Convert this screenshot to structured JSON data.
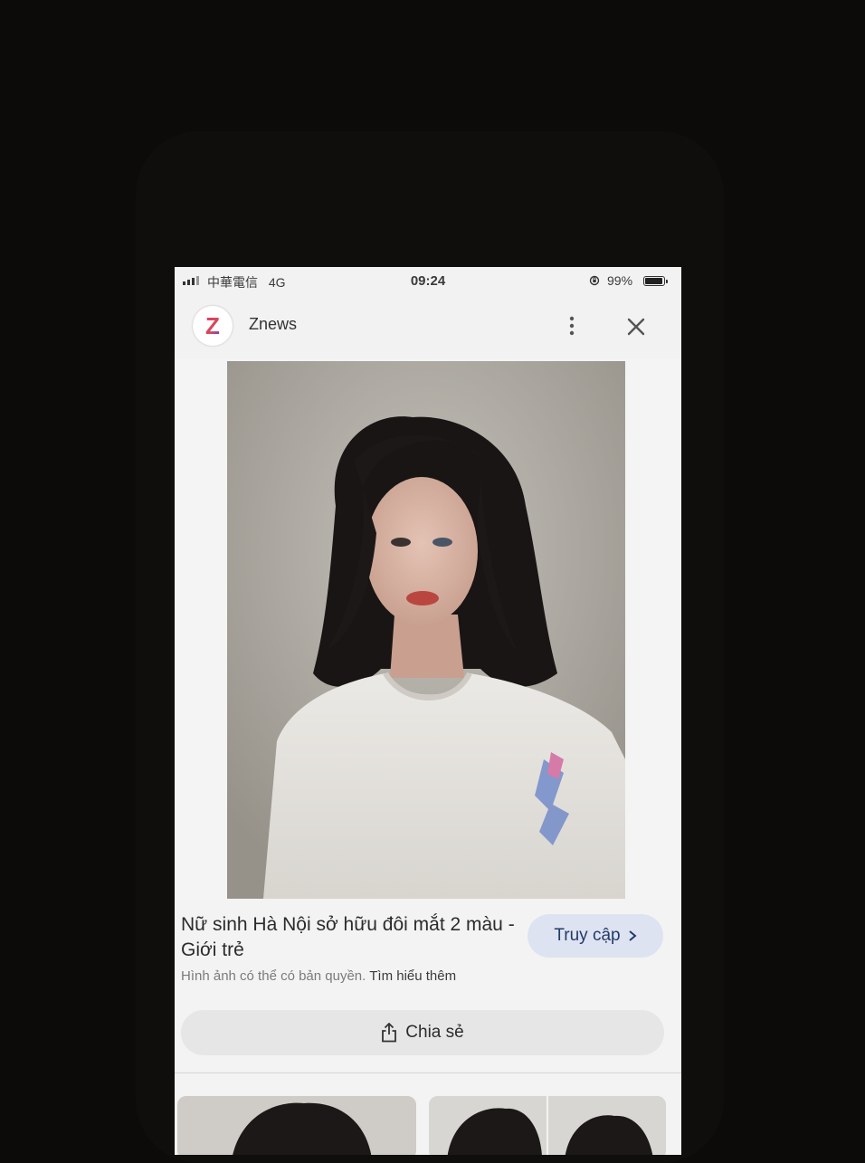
{
  "status_bar": {
    "carrier": "中華電信",
    "network": "4G",
    "time": "09:24",
    "battery": "99%"
  },
  "header": {
    "logo_letter": "Z",
    "site_name": "Znews"
  },
  "result": {
    "title": "Nữ sinh Hà Nội sở hữu đôi mắt 2 màu - Giới trẻ",
    "visit_label": "Truy cập",
    "copyright_text": "Hình ảnh có thể có bản quyền.",
    "learn_more": "Tìm hiểu thêm",
    "share_label": "Chia sẻ"
  },
  "icons": {
    "menu": "more-vertical-icon",
    "close": "close-icon",
    "lens": "lens-icon",
    "share": "share-icon",
    "visit": "chevron-right-icon"
  },
  "colors": {
    "logo_gradient": [
      "#e83d6f",
      "#6c3fd4"
    ],
    "visit_button_bg": "#dde3f0",
    "visit_button_text": "#233a6b"
  }
}
